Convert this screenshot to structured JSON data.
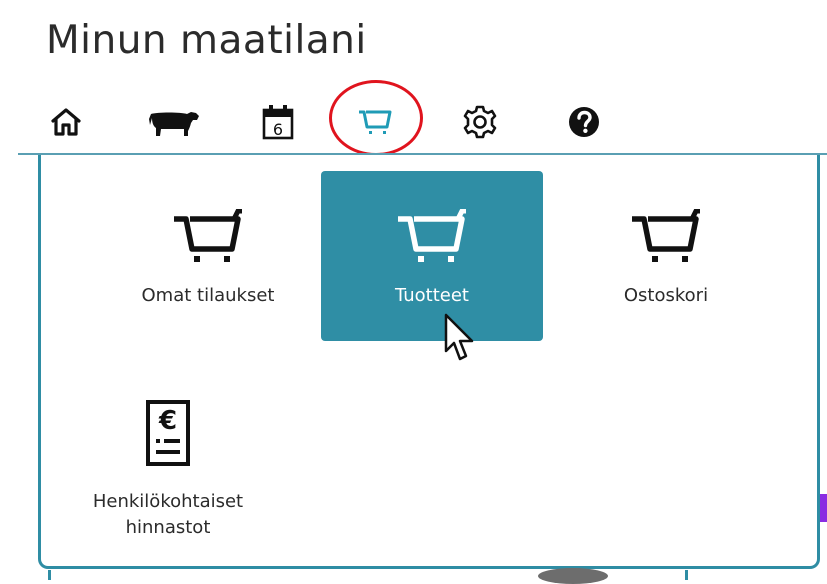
{
  "header": {
    "title": "Minun maatilani",
    "calendar_day": "6",
    "nav_icons": [
      {
        "name": "home-icon"
      },
      {
        "name": "cattle-icon"
      },
      {
        "name": "calendar-icon"
      },
      {
        "name": "shopping-cart-icon",
        "highlighted": true
      },
      {
        "name": "settings-gear-icon"
      },
      {
        "name": "help-icon"
      }
    ]
  },
  "colors": {
    "accent": "#2f8ea5",
    "highlight_ring": "#e0141e",
    "text": "#2b2b2b",
    "active_label": "#ffffff"
  },
  "menu": {
    "items": [
      {
        "label": "Omat tilaukset",
        "icon": "shopping-cart-icon",
        "active": false
      },
      {
        "label": "Tuotteet",
        "icon": "shopping-cart-icon",
        "active": true
      },
      {
        "label": "Ostoskori",
        "icon": "shopping-cart-icon",
        "active": false
      },
      {
        "label_line1": "Henkilökohtaiset",
        "label_line2": "hinnastot",
        "icon": "euro-pricelist-icon",
        "active": false
      }
    ]
  }
}
